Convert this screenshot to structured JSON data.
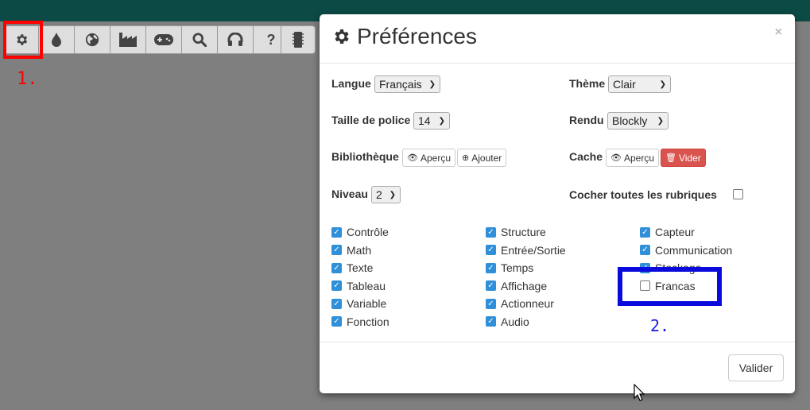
{
  "toolbar": {
    "icons": [
      "gear-icon",
      "drop-icon",
      "globe-icon",
      "factory-icon",
      "gamepad-icon",
      "search-icon",
      "headset-icon",
      "help-icon"
    ],
    "help_label": "?",
    "chip_icon": "chip-icon"
  },
  "annotations": {
    "step1": "1.",
    "step2": "2.",
    "step1_color": "#ff0000",
    "step2_color": "#0a0add"
  },
  "modal": {
    "title": "Préférences",
    "close": "×",
    "langue_label": "Langue",
    "langue_value": "Français",
    "theme_label": "Thème",
    "theme_value": "Clair",
    "taille_label": "Taille de police",
    "taille_value": "14",
    "rendu_label": "Rendu",
    "rendu_value": "Blockly",
    "biblio_label": "Bibliothèque",
    "biblio_apercu": "Aperçu",
    "biblio_ajouter": "Ajouter",
    "cache_label": "Cache",
    "cache_apercu": "Aperçu",
    "cache_vider": "Vider",
    "niveau_label": "Niveau",
    "niveau_value": "2",
    "cocher_label": "Cocher toutes les rubriques",
    "cocher_checked": false,
    "categories": {
      "col1": [
        {
          "label": "Contrôle",
          "checked": true
        },
        {
          "label": "Math",
          "checked": true
        },
        {
          "label": "Texte",
          "checked": true
        },
        {
          "label": "Tableau",
          "checked": true
        },
        {
          "label": "Variable",
          "checked": true
        },
        {
          "label": "Fonction",
          "checked": true
        }
      ],
      "col2": [
        {
          "label": "Structure",
          "checked": true
        },
        {
          "label": "Entrée/Sortie",
          "checked": true
        },
        {
          "label": "Temps",
          "checked": true
        },
        {
          "label": "Affichage",
          "checked": true
        },
        {
          "label": "Actionneur",
          "checked": true
        },
        {
          "label": "Audio",
          "checked": true
        }
      ],
      "col3": [
        {
          "label": "Capteur",
          "checked": true
        },
        {
          "label": "Communication",
          "checked": true
        },
        {
          "label": "Stockage",
          "checked": true
        },
        {
          "label": "Francas",
          "checked": false
        }
      ]
    },
    "valider": "Valider"
  }
}
